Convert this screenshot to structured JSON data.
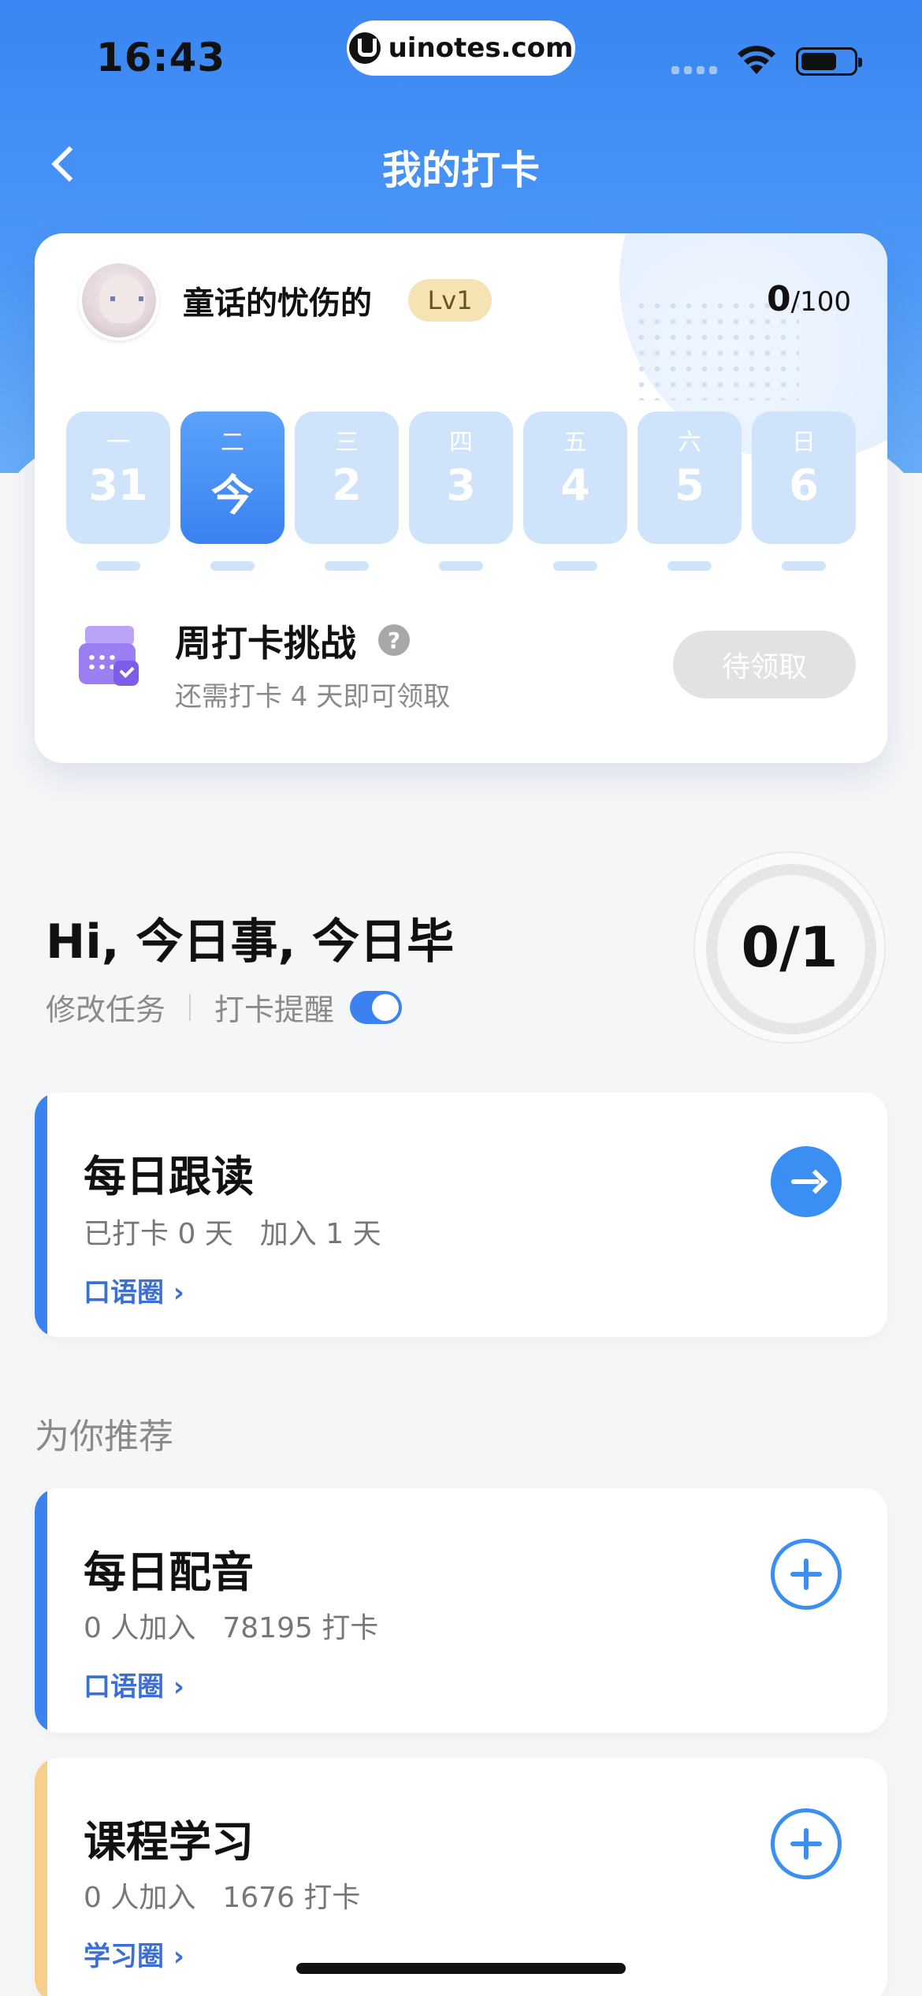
{
  "status_bar": {
    "time": "16:43",
    "url": "uinotes.com"
  },
  "nav": {
    "title": "我的打卡"
  },
  "profile": {
    "username": "童话的忧伤的",
    "level": "Lv1",
    "score": "0",
    "score_total": "/100"
  },
  "week": [
    {
      "weekday": "一",
      "label": "31",
      "active": false
    },
    {
      "weekday": "二",
      "label": "今",
      "active": true
    },
    {
      "weekday": "三",
      "label": "2",
      "active": false
    },
    {
      "weekday": "四",
      "label": "3",
      "active": false
    },
    {
      "weekday": "五",
      "label": "4",
      "active": false
    },
    {
      "weekday": "六",
      "label": "5",
      "active": false
    },
    {
      "weekday": "日",
      "label": "6",
      "active": false
    }
  ],
  "challenge": {
    "title": "周打卡挑战",
    "help": "?",
    "subtitle": "还需打卡 4 天即可领取",
    "button": "待领取"
  },
  "today": {
    "greeting": "Hi, 今日事, 今日毕",
    "edit_task": "修改任务",
    "reminder": "打卡提醒",
    "reminder_on": true,
    "progress": "0/1"
  },
  "tasks": [
    {
      "title": "每日跟读",
      "meta": [
        "已打卡 0 天",
        "加入 1 天"
      ],
      "link": "口语圈 ›"
    }
  ],
  "recommend": {
    "title": "为你推荐",
    "items": [
      {
        "title": "每日配音",
        "meta": [
          "0 人加入",
          "78195 打卡"
        ],
        "link": "口语圈 ›"
      },
      {
        "title": "课程学习",
        "meta": [
          "0 人加入",
          "1676 打卡"
        ],
        "link": "学习圈 ›"
      }
    ]
  },
  "colors": {
    "primary": "#3b82f0",
    "accent_orange": "#f8cf8a",
    "link": "#3b6fd6"
  }
}
